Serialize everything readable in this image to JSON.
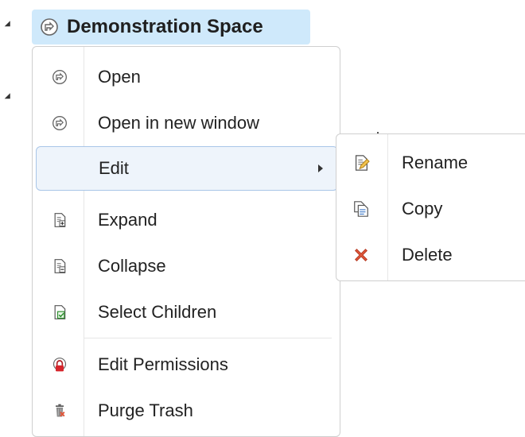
{
  "tree": {
    "root_label": "Demonstration Space"
  },
  "menu": {
    "items": [
      {
        "label": "Open",
        "icon": "space-icon"
      },
      {
        "label": "Open in new window",
        "icon": "space-icon"
      },
      {
        "label": "Edit",
        "icon": "",
        "has_submenu": true
      },
      {
        "label": "Expand",
        "icon": "expand-doc-icon"
      },
      {
        "label": "Collapse",
        "icon": "collapse-doc-icon"
      },
      {
        "label": "Select Children",
        "icon": "select-children-icon"
      },
      {
        "label": "Edit Permissions",
        "icon": "lock-space-icon"
      },
      {
        "label": "Purge Trash",
        "icon": "trash-icon"
      }
    ]
  },
  "submenu": {
    "items": [
      {
        "label": "Rename",
        "icon": "rename-doc-icon"
      },
      {
        "label": "Copy",
        "icon": "copy-doc-icon"
      },
      {
        "label": "Delete",
        "icon": "delete-x-icon"
      }
    ]
  },
  "colors": {
    "selected_bg": "#cfe9fb",
    "hover_bg": "#eef4fb",
    "hover_border": "#a9c6e8",
    "delete_red": "#e0563a",
    "lock_red": "#d6252b"
  }
}
